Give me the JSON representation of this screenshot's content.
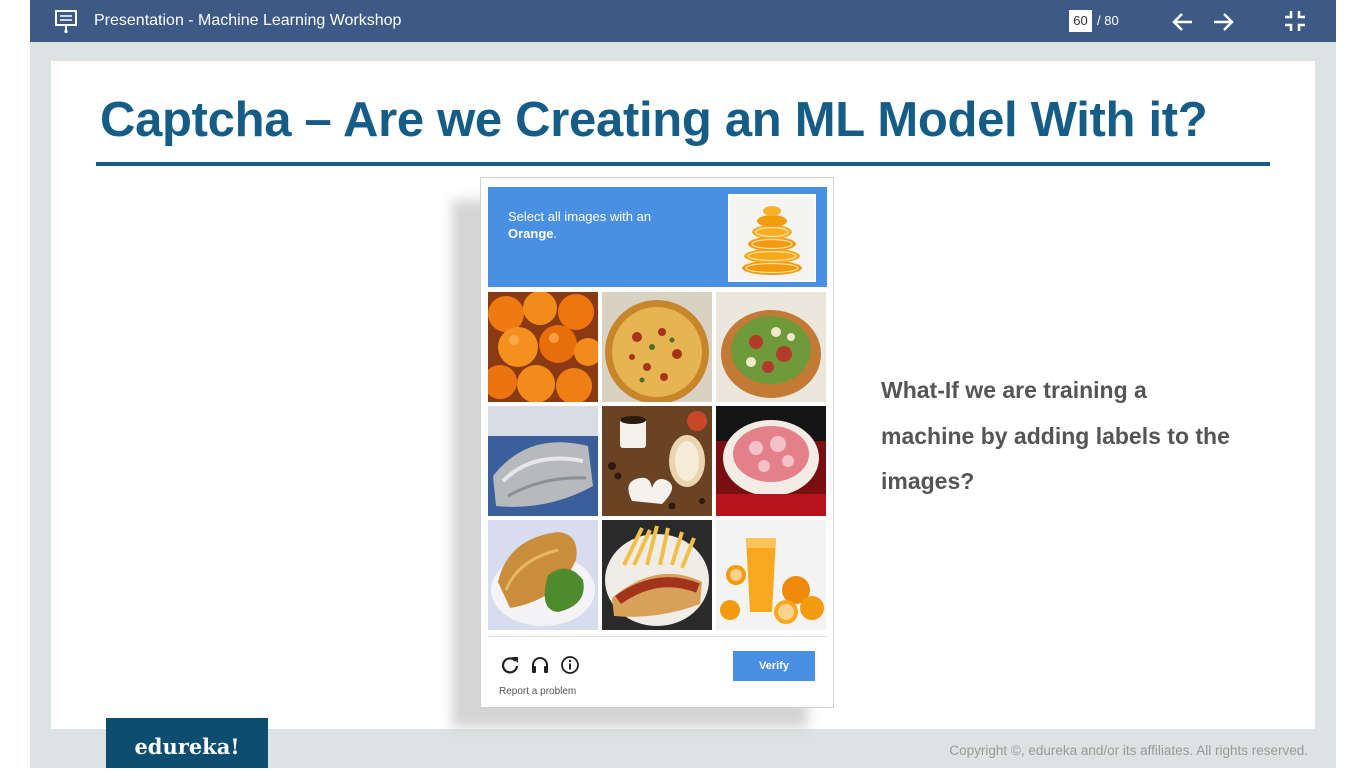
{
  "topbar": {
    "title": "Presentation - Machine Learning Workshop",
    "page_current": "60",
    "page_total": "/ 80",
    "icons": [
      "presentation-icon",
      "arrow-left-icon",
      "arrow-right-icon",
      "exit-fullscreen-icon"
    ]
  },
  "slide": {
    "title": "Captcha – Are we Creating an ML Model With it?",
    "side_text": "What-If we are training a machine by adding labels to the images?"
  },
  "captcha": {
    "prompt_line1": "Select all images with an",
    "prompt_target": "Orange",
    "prompt_period": ".",
    "tiles": [
      "oranges",
      "pizza",
      "salad",
      "foil-wrapped-bread",
      "coffee-and-cookies",
      "meat-platter",
      "sandwich",
      "hot-dog-and-fries",
      "orange-juice"
    ],
    "footer_icons": [
      "reload-icon",
      "headphones-icon",
      "info-icon"
    ],
    "report": "Report a problem",
    "verify": "Verify",
    "colors": {
      "header": "#4a90e2",
      "button": "#4a90e2"
    }
  },
  "footer": {
    "logo": "edureka!",
    "copyright": "Copyright ©, edureka and/or its affiliates. All rights reserved."
  },
  "colors": {
    "topbar": "#3d5a87",
    "title": "#155d86",
    "logo_bg": "#0d4d70",
    "frame": "#dde2e2"
  }
}
